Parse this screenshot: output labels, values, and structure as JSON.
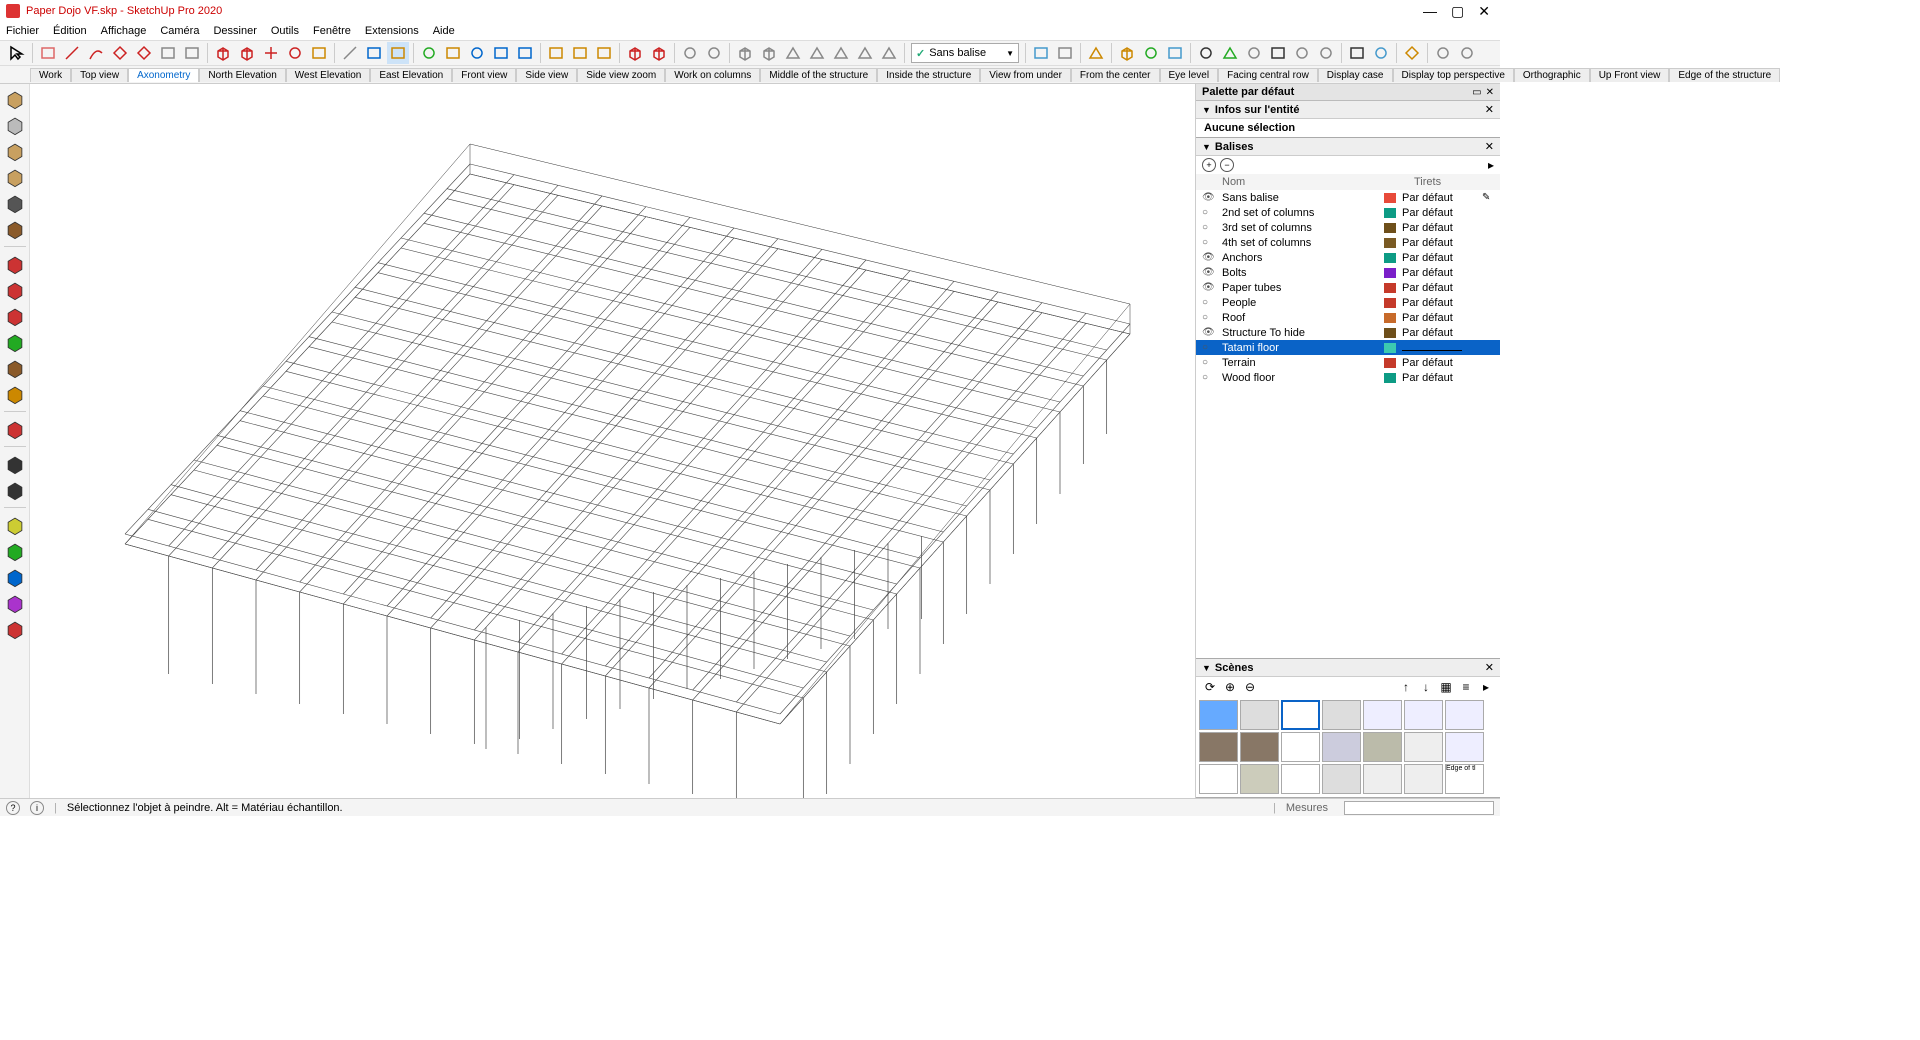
{
  "title": "Paper Dojo VF.skp - SketchUp Pro 2020",
  "menus": [
    "Fichier",
    "Édition",
    "Affichage",
    "Caméra",
    "Dessiner",
    "Outils",
    "Fenêtre",
    "Extensions",
    "Aide"
  ],
  "tagDropdown": "Sans balise",
  "sceneTabs": [
    "Work",
    "Top view",
    "Axonometry",
    "North Elevation",
    "West Elevation",
    "East Elevation",
    "Front view",
    "Side view",
    "Side view zoom",
    "Work on columns",
    "Middle of the structure",
    "Inside the structure",
    "View from under",
    "From the center",
    "Eye level",
    "Facing central row",
    "Display case",
    "Display top perspective",
    "Orthographic",
    "Up Front view",
    "Edge of the structure"
  ],
  "activeSceneTab": 2,
  "panels": {
    "tray": "Palette par défaut",
    "entity": {
      "header": "Infos sur l'entité",
      "body": "Aucune sélection"
    },
    "tags": {
      "header": "Balises",
      "cols": {
        "name": "Nom",
        "tirets": "Tirets"
      },
      "defaultTirets": "Par défaut",
      "rows": [
        {
          "name": "Sans balise",
          "color": "#e84a3a",
          "vis": "eye",
          "pen": true
        },
        {
          "name": "2nd set of columns",
          "color": "#0d9b84",
          "vis": "o"
        },
        {
          "name": "3rd set of columns",
          "color": "#6e4f1a",
          "vis": "o"
        },
        {
          "name": "4th set of columns",
          "color": "#7a5a23",
          "vis": "o"
        },
        {
          "name": "Anchors",
          "color": "#0d9b84",
          "vis": "eye"
        },
        {
          "name": "Bolts",
          "color": "#7b1fc9",
          "vis": "eye"
        },
        {
          "name": "Paper tubes",
          "color": "#c53a2a",
          "vis": "eye"
        },
        {
          "name": "People",
          "color": "#c53a2a",
          "vis": "o"
        },
        {
          "name": "Roof",
          "color": "#c76a2a",
          "vis": "o"
        },
        {
          "name": "Structure To hide",
          "color": "#6e4f1a",
          "vis": "eye"
        },
        {
          "name": "Tatami floor",
          "color": "#3cc9b0",
          "vis": "o",
          "sel": true
        },
        {
          "name": "Terrain",
          "color": "#c53a2a",
          "vis": "o"
        },
        {
          "name": "Wood floor",
          "color": "#0d9b84",
          "vis": "o"
        }
      ]
    },
    "scenes": {
      "header": "Scènes",
      "lastLabel": "Edge of tl"
    }
  },
  "status": {
    "msg": "Sélectionnez l'objet à peindre. Alt = Matériau échantillon.",
    "measures": "Mesures"
  }
}
